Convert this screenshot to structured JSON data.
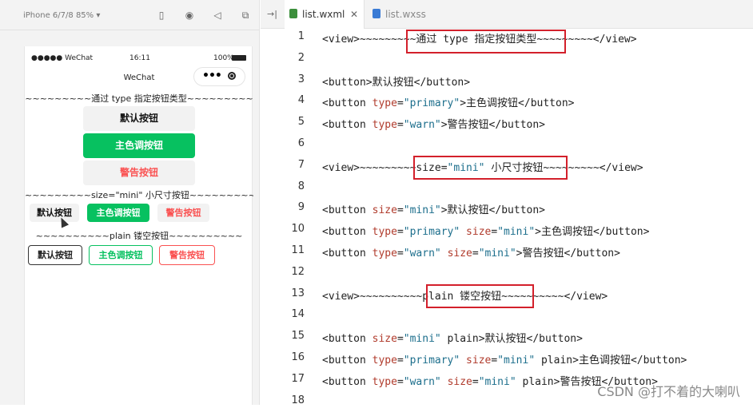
{
  "simulator": {
    "device": "iPhone 6/7/8 85% ▾",
    "status": {
      "carrier": "●●●●● WeChat",
      "time": "16:11",
      "battery": "100%"
    },
    "nav_title": "WeChat",
    "capsule_more": "•••",
    "preview": {
      "header1": "~~~~~~~~~通过 type 指定按钮类型~~~~~~~~~",
      "header2": "~~~~~~~~~size=\"mini\" 小尺寸按钮~~~~~~~~~",
      "header3": "~~~~~~~~~~plain 镂空按钮~~~~~~~~~~",
      "default_label": "默认按钮",
      "primary_label": "主色调按钮",
      "warn_label": "警告按钮"
    }
  },
  "editor": {
    "tabs": [
      {
        "label": "list.wxml",
        "active": true
      },
      {
        "label": "list.wxss",
        "active": false
      }
    ],
    "lines": [
      {
        "n": "1",
        "t": "<view>~~~~~~~~~通过 type 指定按钮类型~~~~~~~~~</view>"
      },
      {
        "n": "2",
        "t": ""
      },
      {
        "n": "3",
        "t": "<button>默认按钮</button>"
      },
      {
        "n": "4",
        "t": "<button type=\"primary\">主色调按钮</button>"
      },
      {
        "n": "5",
        "t": "<button type=\"warn\">警告按钮</button>"
      },
      {
        "n": "6",
        "t": ""
      },
      {
        "n": "7",
        "t": "<view>~~~~~~~~~size=\"mini\" 小尺寸按钮~~~~~~~~~</view>"
      },
      {
        "n": "8",
        "t": ""
      },
      {
        "n": "9",
        "t": "<button size=\"mini\">默认按钮</button>"
      },
      {
        "n": "10",
        "t": "<button type=\"primary\" size=\"mini\">主色调按钮</button>"
      },
      {
        "n": "11",
        "t": "<button type=\"warn\" size=\"mini\">警告按钮</button>"
      },
      {
        "n": "12",
        "t": ""
      },
      {
        "n": "13",
        "t": "<view>~~~~~~~~~~plain 镂空按钮~~~~~~~~~~</view>"
      },
      {
        "n": "14",
        "t": ""
      },
      {
        "n": "15",
        "t": "<button size=\"mini\" plain>默认按钮</button>"
      },
      {
        "n": "16",
        "t": "<button type=\"primary\" size=\"mini\" plain>主色调按钮</button>"
      },
      {
        "n": "17",
        "t": "<button type=\"warn\" size=\"mini\" plain>警告按钮</button>"
      },
      {
        "n": "18",
        "t": ""
      }
    ]
  },
  "watermark": "CSDN @打不着的大喇叭",
  "colors": {
    "primary": "#07c160",
    "warn": "#fa5151",
    "highlight": "#d3202b"
  }
}
